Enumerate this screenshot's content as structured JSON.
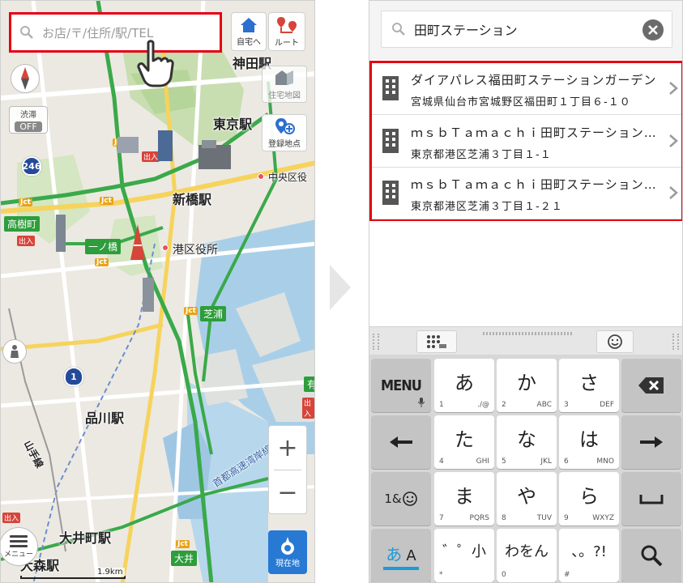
{
  "map": {
    "search_placeholder": "お店/〒/住所/駅/TEL",
    "home_button_label": "自宅へ",
    "route_button_label": "ルート",
    "home_map_label": "住宅地図",
    "register_label": "登録地点",
    "traffic_label": "渋滞",
    "traffic_state": "OFF",
    "zoom_in": "+",
    "zoom_out": "−",
    "menu_label": "メニュー",
    "current_location_label": "現在地",
    "scale_label": "1.9km",
    "labels": {
      "kanda": "神田駅",
      "tokyo": "東京駅",
      "shimbashi": "新橋駅",
      "minato_office": "港区役所",
      "chuo_office": "中央区役",
      "shinagawa": "品川駅",
      "oimachi": "大井町駅",
      "yamanote": "山手線",
      "shuto_wangan": "首都高速湾岸線",
      "omori_station": "大森駅"
    },
    "tags": {
      "takagicho": "高樹町",
      "ichinohashi": "一ノ橋",
      "shibaura": "芝浦",
      "ooi": "大井",
      "ari": "有",
      "jct": "Jct",
      "exit": "出入"
    },
    "shields": {
      "r246": "246",
      "r1": "1"
    }
  },
  "phone": {
    "search_value": "田町ステーション",
    "results": [
      {
        "name": "ダイアパレス福田町ステーションガーデン",
        "address": "宮城県仙台市宮城野区福田町１丁目６‐１０"
      },
      {
        "name": "ｍｓｂＴａｍａｃｈｉ田町ステーションタワーＳ",
        "address": "東京都港区芝浦３丁目１‐１"
      },
      {
        "name": "ｍｓｂＴａｍａｃｈｉ田町ステーションタワーＮ",
        "address": "東京都港区芝浦３丁目１‐２１"
      }
    ],
    "keyboard": {
      "menu": "MENU",
      "keys": [
        {
          "main": "あ",
          "num": "1",
          "sub": "./@"
        },
        {
          "main": "か",
          "num": "2",
          "sub": "ABC"
        },
        {
          "main": "さ",
          "num": "3",
          "sub": "DEF"
        },
        {
          "main": "た",
          "num": "4",
          "sub": "GHI"
        },
        {
          "main": "な",
          "num": "5",
          "sub": "JKL"
        },
        {
          "main": "は",
          "num": "6",
          "sub": "MNO"
        },
        {
          "main": "ま",
          "num": "7",
          "sub": "PQRS"
        },
        {
          "main": "や",
          "num": "8",
          "sub": "TUV"
        },
        {
          "main": "ら",
          "num": "9",
          "sub": "WXYZ"
        },
        {
          "main": "゛゜小",
          "num": "*",
          "sub": ""
        },
        {
          "main": "わをん",
          "num": "0",
          "sub": ""
        },
        {
          "main": "、。?!",
          "num": "#",
          "sub": ""
        }
      ],
      "symbol_key": "1&",
      "mode_key_a": "あ",
      "mode_key_b": "A"
    }
  }
}
